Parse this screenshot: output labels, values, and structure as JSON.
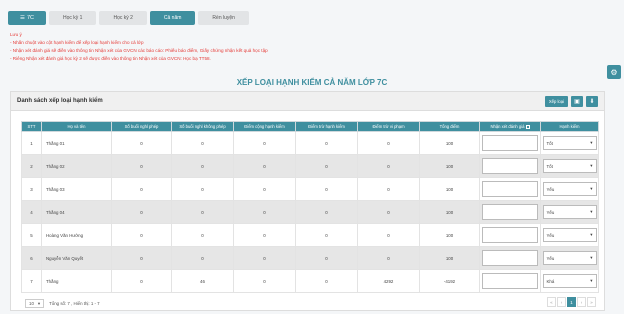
{
  "class_button": {
    "icon": "list-icon",
    "label": "7C"
  },
  "tabs": [
    {
      "label": "Học kỳ 1",
      "active": false
    },
    {
      "label": "Học kỳ 2",
      "active": false
    },
    {
      "label": "Cả năm",
      "active": true
    },
    {
      "label": "Rèn luyện",
      "active": false
    }
  ],
  "notes": [
    "Lưu ý",
    "- Nhấn chuột vào cột hạnh kiểm để xếp loại hạnh kiểm cho cả lớp",
    "- Nhận xét đánh giá sẽ điền vào thông tin Nhận xét của GVCN các báo cáo: Phiếu báo điểm, Giấy chứng nhận kết quả học tập",
    "- Riêng Nhận xét đánh giá học kỳ 2 sẽ được điền vào thông tin Nhận xét của GVCN: Học bạ TT58."
  ],
  "heading": "XẾP LOẠI HẠNH KIỂM CẢ NĂM LỚP 7C",
  "panel": {
    "title": "Danh sách xếp loại hạnh kiểm",
    "actions": {
      "rank_label": "Xếp loại",
      "save_icon": "save-icon",
      "download_icon": "download-icon"
    }
  },
  "table": {
    "headers": [
      "STT",
      "Họ và tên",
      "Số buổi nghỉ phép",
      "Số buổi nghỉ không phép",
      "Điểm cộng hạnh kiểm",
      "Điểm trừ hạnh kiểm",
      "Điểm trừ vi phạm",
      "Tổng điểm",
      "Nhận xét đánh giá",
      "Hạnh kiểm"
    ],
    "rows": [
      {
        "stt": "1",
        "name": "Thắng 01",
        "excused": "0",
        "unexcused": "0",
        "plus": "0",
        "minus": "0",
        "violation": "0",
        "total": "100",
        "comment": "",
        "conduct": "Tốt"
      },
      {
        "stt": "2",
        "name": "Thắng 02",
        "excused": "0",
        "unexcused": "0",
        "plus": "0",
        "minus": "0",
        "violation": "0",
        "total": "100",
        "comment": "",
        "conduct": "Tốt"
      },
      {
        "stt": "3",
        "name": "Thắng 03",
        "excused": "0",
        "unexcused": "0",
        "plus": "0",
        "minus": "0",
        "violation": "0",
        "total": "100",
        "comment": "",
        "conduct": "Yếu"
      },
      {
        "stt": "4",
        "name": "Thắng 04",
        "excused": "0",
        "unexcused": "0",
        "plus": "0",
        "minus": "0",
        "violation": "0",
        "total": "100",
        "comment": "",
        "conduct": "Yếu"
      },
      {
        "stt": "5",
        "name": "Hoàng Văn Hưởng",
        "excused": "0",
        "unexcused": "0",
        "plus": "0",
        "minus": "0",
        "violation": "0",
        "total": "100",
        "comment": "",
        "conduct": "Yếu"
      },
      {
        "stt": "6",
        "name": "Nguyễn Văn Quyết",
        "excused": "0",
        "unexcused": "0",
        "plus": "0",
        "minus": "0",
        "violation": "0",
        "total": "100",
        "comment": "",
        "conduct": "Yếu"
      },
      {
        "stt": "7",
        "name": "Thắng",
        "excused": "0",
        "unexcused": "46",
        "plus": "0",
        "minus": "0",
        "violation": "4292",
        "total": "-4192",
        "comment": "",
        "conduct": "Khá"
      }
    ]
  },
  "footer": {
    "page_size": "10",
    "summary": "Tổng số: 7 , Hiển thị: 1 - 7"
  },
  "pager": {
    "first": "«",
    "prev": "‹",
    "current": "1",
    "next": "›",
    "last": "»"
  }
}
